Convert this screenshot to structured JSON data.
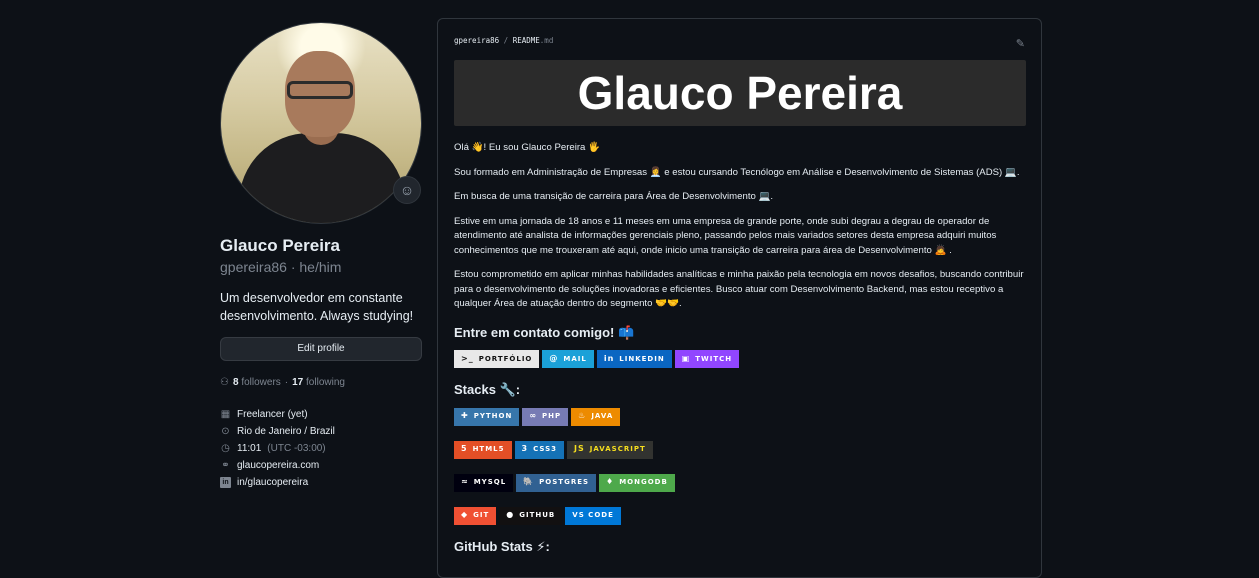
{
  "profile": {
    "name": "Glauco Pereira",
    "login": "gpereira86",
    "pronouns": "he/him",
    "bio": "Um desenvolvedor em constante desenvolvimento. Always studying!",
    "edit_label": "Edit profile",
    "followers_count": "8",
    "followers_label": "followers",
    "following_count": "17",
    "following_label": "following",
    "details": {
      "company": "Freelancer (yet)",
      "location": "Rio de Janeiro / Brazil",
      "time": "11:01",
      "timezone": "(UTC -03:00)",
      "website": "glaucopereira.com",
      "linkedin": "in/glaucopereira"
    }
  },
  "readme": {
    "crumb_user": "gpereira86",
    "crumb_sep": "/",
    "crumb_file": "README",
    "crumb_ext": ".md",
    "banner_title": "Glauco Pereira",
    "paragraphs": [
      "Olá 👋! Eu sou Glauco Pereira 🖐️",
      "Sou formado em Administração de Empresas 👩‍💼 e estou cursando Tecnólogo em Análise e Desenvolvimento de Sistemas (ADS) 💻.",
      "Em busca de uma transição de carreira para Área de Desenvolvimento 💻.",
      "Estive em uma jornada de 18 anos e 11 meses em uma empresa de grande porte, onde subi degrau a degrau de operador de atendimento até analista de informações gerenciais pleno, passando pelos mais variados setores desta empresa adquiri muitos conhecimentos que me trouxeram até aqui, onde inicio uma transição de carreira para área de Desenvolvimento 🙇 .",
      "Estou comprometido em aplicar minhas habilidades analíticas e minha paixão pela tecnologia em novos desafios, buscando contribuir para o desenvolvimento de soluções inovadoras e eficientes. Busco atuar com Desenvolvimento Backend, mas estou receptivo a qualquer Área de atuação dentro do segmento 🤝🤝."
    ],
    "contact_heading": "Entre em contato comigo! 📫",
    "contact_badges": [
      {
        "label": "PORTFÓLIO",
        "icon": ">_",
        "bg": "#e8e8e8",
        "fg": "#111111"
      },
      {
        "label": "MAIL",
        "icon": "@",
        "bg": "#1ba1d8",
        "fg": "#ffffff"
      },
      {
        "label": "LINKEDIN",
        "icon": "in",
        "bg": "#0a66c2",
        "fg": "#ffffff"
      },
      {
        "label": "TWITCH",
        "icon": "▣",
        "bg": "#9146ff",
        "fg": "#ffffff"
      }
    ],
    "stacks_heading": "Stacks 🔧:",
    "stack_rows": [
      [
        {
          "label": "PYTHON",
          "icon": "✚",
          "bg": "#3776ab",
          "fg": "#ffffff"
        },
        {
          "label": "PHP",
          "icon": "∞",
          "bg": "#777bb4",
          "fg": "#ffffff"
        },
        {
          "label": "JAVA",
          "icon": "♨",
          "bg": "#ed8b00",
          "fg": "#ffffff"
        }
      ],
      [
        {
          "label": "HTML5",
          "icon": "5",
          "bg": "#e34f26",
          "fg": "#ffffff"
        },
        {
          "label": "CSS3",
          "icon": "3",
          "bg": "#1572b6",
          "fg": "#ffffff"
        },
        {
          "label": "JAVASCRIPT",
          "icon": "JS",
          "bg": "#323330",
          "fg": "#f7df1e"
        }
      ],
      [
        {
          "label": "MYSQL",
          "icon": "≈",
          "bg": "#00000f",
          "fg": "#ffffff"
        },
        {
          "label": "POSTGRES",
          "icon": "🐘",
          "bg": "#316192",
          "fg": "#ffffff"
        },
        {
          "label": "MONGODB",
          "icon": "♦",
          "bg": "#4ea94b",
          "fg": "#ffffff"
        }
      ],
      [
        {
          "label": "GIT",
          "icon": "◆",
          "bg": "#f05033",
          "fg": "#ffffff"
        },
        {
          "label": "GITHUB",
          "icon": "●",
          "bg": "#121011",
          "fg": "#ffffff"
        },
        {
          "label": "VS CODE",
          "icon": "",
          "bg": "#0078d7",
          "fg": "#ffffff"
        }
      ]
    ],
    "stats_heading": "GitHub Stats ⚡:"
  },
  "colors": {
    "background": "#0d1117",
    "border": "#30363d",
    "muted": "#7d8590"
  }
}
